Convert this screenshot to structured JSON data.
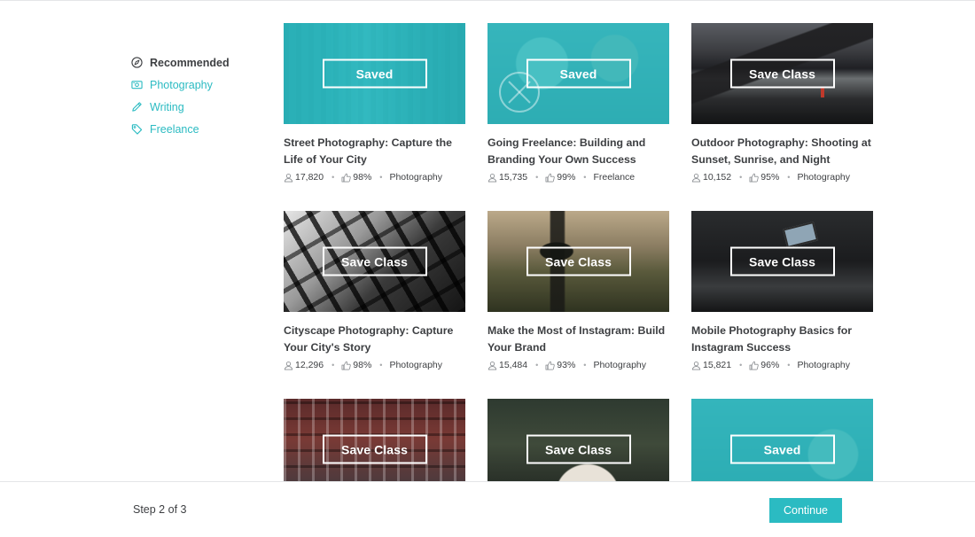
{
  "sidebar": {
    "items": [
      {
        "label": "Recommended",
        "icon": "compass-icon"
      },
      {
        "label": "Photography",
        "icon": "photo-icon"
      },
      {
        "label": "Writing",
        "icon": "pencil-icon"
      },
      {
        "label": "Freelance",
        "icon": "tag-icon"
      }
    ]
  },
  "colors": {
    "accent": "#2bbbc2",
    "text": "#3d3f42",
    "muted": "#a7a9ac"
  },
  "classes": [
    {
      "title": "Street Photography: Capture the Life of Your City",
      "students": "17,820",
      "rating": "98%",
      "category": "Photography",
      "button": "Saved"
    },
    {
      "title": "Going Freelance: Building and Branding Your Own Success",
      "students": "15,735",
      "rating": "99%",
      "category": "Freelance",
      "button": "Saved"
    },
    {
      "title": "Outdoor Photography: Shooting at Sunset, Sunrise, and Night",
      "students": "10,152",
      "rating": "95%",
      "category": "Photography",
      "button": "Save Class"
    },
    {
      "title": "Cityscape Photography: Capture Your City's Story",
      "students": "12,296",
      "rating": "98%",
      "category": "Photography",
      "button": "Save Class"
    },
    {
      "title": "Make the Most of Instagram: Build Your Brand",
      "students": "15,484",
      "rating": "93%",
      "category": "Photography",
      "button": "Save Class"
    },
    {
      "title": "Mobile Photography Basics for Instagram Success",
      "students": "15,821",
      "rating": "96%",
      "category": "Photography",
      "button": "Save Class"
    },
    {
      "title": "",
      "students": "",
      "rating": "",
      "category": "",
      "button": "Save Class"
    },
    {
      "title": "",
      "students": "",
      "rating": "",
      "category": "",
      "button": "Save Class"
    },
    {
      "title": "",
      "students": "",
      "rating": "",
      "category": "",
      "button": "Saved"
    }
  ],
  "footer": {
    "step": "Step 2 of 3",
    "continue_label": "Continue"
  }
}
